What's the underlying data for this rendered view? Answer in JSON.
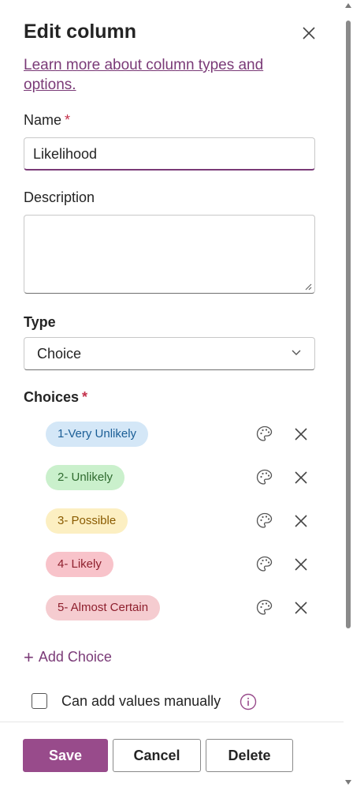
{
  "panel": {
    "title": "Edit column",
    "learn_more_link": "Learn more about column types and options."
  },
  "name_field": {
    "label": "Name",
    "required_mark": "*",
    "value": "Likelihood"
  },
  "description_field": {
    "label": "Description",
    "value": ""
  },
  "type_field": {
    "label": "Type",
    "value": "Choice"
  },
  "choices": {
    "label": "Choices",
    "required_mark": "*",
    "items": [
      {
        "label": "1-Very Unlikely",
        "bg": "#d4e7f7",
        "fg": "#1b5e96"
      },
      {
        "label": "2- Unlikely",
        "bg": "#caf0cc",
        "fg": "#2f6b2f"
      },
      {
        "label": "3- Possible",
        "bg": "#fcefc2",
        "fg": "#8a5b00"
      },
      {
        "label": "4- Likely",
        "bg": "#f8c3ca",
        "fg": "#8e1f2d"
      },
      {
        "label": "5- Almost Certain",
        "bg": "#f5ccd0",
        "fg": "#8e1f2d"
      }
    ],
    "add_label": "Add Choice"
  },
  "manual_values": {
    "label": "Can add values manually",
    "checked": false
  },
  "footer": {
    "save": "Save",
    "cancel": "Cancel",
    "delete": "Delete"
  },
  "colors": {
    "accent": "#984b8b",
    "link": "#7a3a77",
    "required": "#c4314b"
  }
}
